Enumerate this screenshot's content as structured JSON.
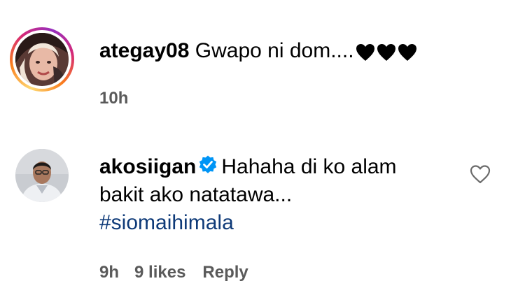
{
  "comments": [
    {
      "username": "ategay08",
      "text": "Gwapo ni dom....",
      "emoji": [
        "black-heart",
        "black-heart",
        "black-heart"
      ],
      "time": "10h",
      "avatar_ring": "story-gradient"
    },
    {
      "username": "akosiigan",
      "verified": true,
      "text": "Hahaha di ko alam bakit ako natatawa...",
      "hashtag": "#siomaihimala",
      "time": "9h",
      "likes": "9 likes",
      "reply_label": "Reply",
      "like_icon": "heart-outline-icon"
    }
  ],
  "colors": {
    "username": "#000000",
    "meta": "#5a5a5a",
    "hashtag": "#0e3a78",
    "verified_badge": "#0095f6"
  }
}
